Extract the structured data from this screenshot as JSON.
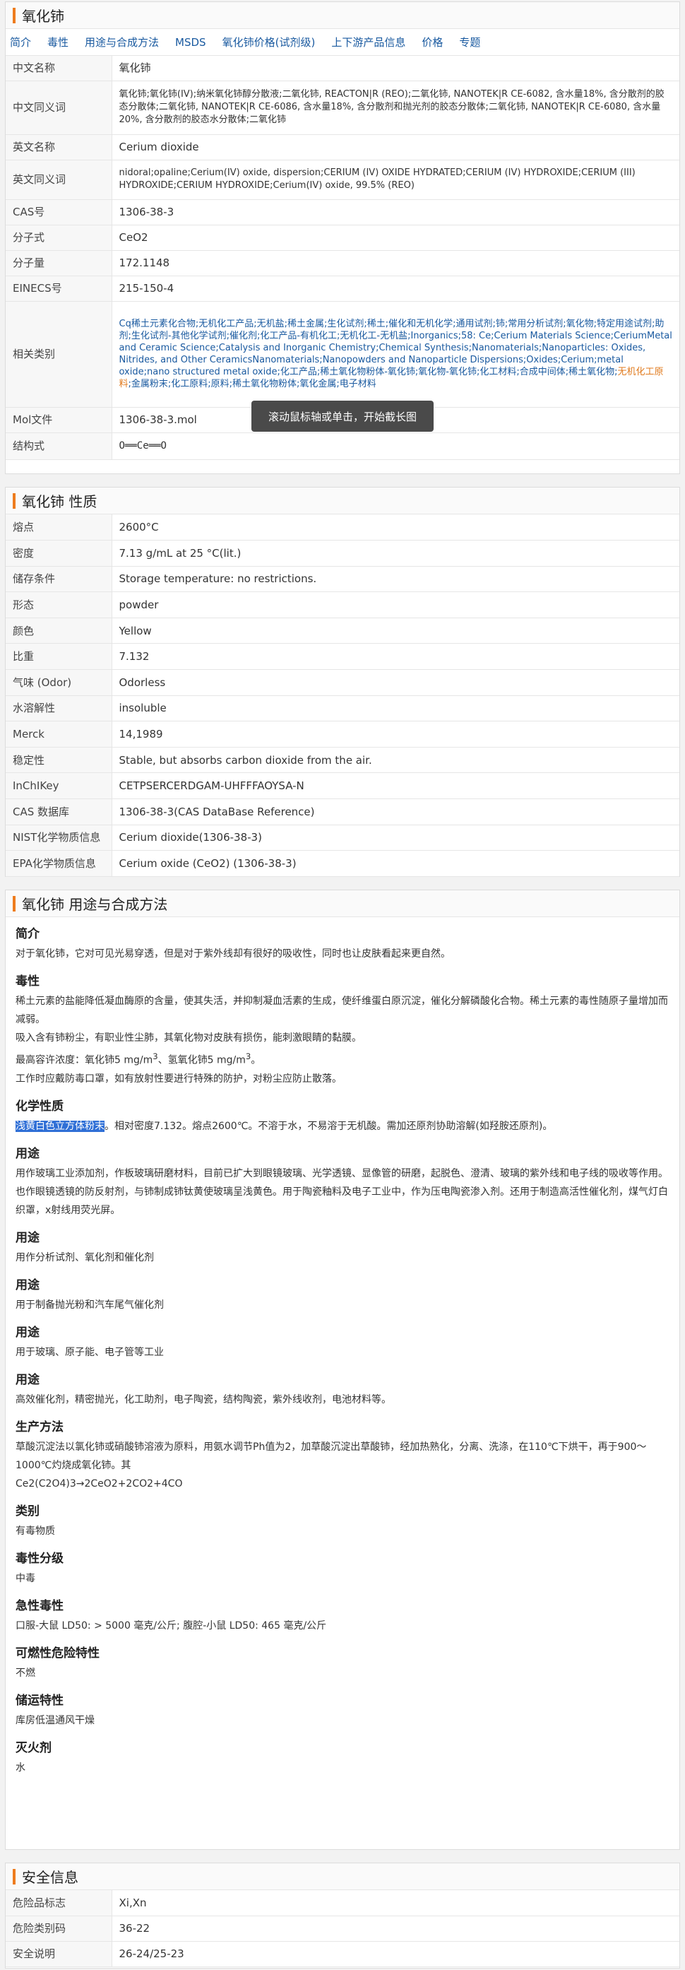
{
  "basic": {
    "title": "氧化铈",
    "nav": [
      "简介",
      "毒性",
      "用途与合成方法",
      "MSDS",
      "氧化铈价格(试剂级)",
      "上下游产品信息",
      "价格",
      "专题"
    ],
    "rows": [
      {
        "k": "中文名称",
        "v": "氧化铈"
      },
      {
        "k": "中文同义词",
        "v": "氧化铈;氧化铈(IV);纳米氧化铈醇分散液;二氧化铈, REACTON|R (REO);二氧化铈, NANOTEK|R CE-6082, 含水量18%, 含分散剂的胶态分散体;二氧化铈, NANOTEK|R CE-6086, 含水量18%, 含分散剂和抛光剂的胶态分散体;二氧化铈, NANOTEK|R CE-6080, 含水量20%, 含分散剂的胶态水分散体;二氧化铈"
      },
      {
        "k": "英文名称",
        "v": "Cerium dioxide"
      },
      {
        "k": "英文同义词",
        "v": "nidoral;opaline;Cerium(IV) oxide, dispersion;CERIUM (IV) OXIDE HYDRATED;CERIUM (IV) HYDROXIDE;CERIUM (III) HYDROXIDE;CERIUM HYDROXIDE;Cerium(IV) oxide, 99.5% (REO)"
      },
      {
        "k": "CAS号",
        "v": "1306-38-3"
      },
      {
        "k": "分子式",
        "v": "CeO2"
      },
      {
        "k": "分子量",
        "v": "172.1148"
      },
      {
        "k": "EINECS号",
        "v": "215-150-4"
      },
      {
        "k": "相关类别",
        "v": ""
      },
      {
        "k": "Mol文件",
        "v": "1306-38-3.mol"
      },
      {
        "k": "结构式",
        "v": ""
      }
    ],
    "category_a": "Cq稀土元素化合物;无机化工产品;无机盐;稀土金属;生化试剂;稀土;催化和无机化学;通用试剂;铈;常用分析试剂;氧化物;特定用途试剂;助剂;生化试剂-其他化学试剂;催化剂;化工产品-有机化工;无机化工-无机盐;Inorganics;58: Ce;Cerium Materials Science;CeriumMetal and Ceramic Science;Catalysis and Inorganic Chemistry;Chemical Synthesis;Nanomaterials;Nanoparticles: Oxides, Nitrides, and Other CeramicsNanomaterials;Nanopowders and Nanoparticle Dispersions;Oxides;Cerium;metal oxide;nano structured metal oxide;化工产品;稀土氧化物粉体-氧化铈;氧化物-氧化铈;化工材料;合成中间体;稀土氧化物;",
    "category_b": "无机化工原料",
    "category_c": ";金属粉末;化工原料;原料;稀土氧化物粉体;氧化金属;电子材料",
    "structure": "O══Ce══O",
    "tooltip": "滚动鼠标轴或单击，开始截长图"
  },
  "props": {
    "title": "氧化铈 性质",
    "rows": [
      {
        "k": "熔点",
        "v": "2600°C"
      },
      {
        "k": "密度",
        "v": "7.13 g/mL at 25 °C(lit.)"
      },
      {
        "k": "储存条件",
        "v": "Storage temperature: no restrictions."
      },
      {
        "k": "形态",
        "v": "powder"
      },
      {
        "k": "颜色",
        "v": "Yellow"
      },
      {
        "k": "比重",
        "v": "7.132"
      },
      {
        "k": "气味 (Odor)",
        "v": "Odorless"
      },
      {
        "k": "水溶解性",
        "v": "insoluble"
      },
      {
        "k": "Merck",
        "v": "14,1989"
      },
      {
        "k": "稳定性",
        "v": "Stable, but absorbs carbon dioxide from the air."
      },
      {
        "k": "InChIKey",
        "v": "CETPSERCERDGAM-UHFFFAOYSA-N"
      },
      {
        "k": "CAS 数据库",
        "v": "1306-38-3(CAS DataBase Reference)"
      },
      {
        "k": "NIST化学物质信息",
        "v": "Cerium dioxide(1306-38-3)"
      },
      {
        "k": "EPA化学物质信息",
        "v": "Cerium oxide (CeO2) (1306-38-3)"
      }
    ]
  },
  "uses": {
    "title": "氧化铈 用途与合成方法",
    "intro_h": "简介",
    "intro": "对于氧化铈，它对可见光易穿透，但是对于紫外线却有很好的吸收性，同时也让皮肤看起来更自然。",
    "tox_h": "毒性",
    "tox1": "稀土元素的盐能降低凝血酶原的含量，使其失活，并抑制凝血活素的生成，使纤维蛋白原沉淀，催化分解磷酸化合物。稀土元素的毒性随原子量增加而减弱。",
    "tox2": "吸入含有铈粉尘，有职业性尘肺，其氧化物对皮肤有损伤，能刺激眼睛的黏膜。",
    "tox3_a": "最高容许浓度：氧化铈5 mg/m",
    "tox3_b": "3",
    "tox3_c": "、氢氧化铈5 mg/m",
    "tox3_d": "3",
    "tox3_e": "。",
    "tox4": "工作时应戴防毒口罩，如有放射性要进行特殊的防护，对粉尘应防止散落。",
    "chem_h": "化学性质",
    "chem_hl": "浅黄白色立方体粉末",
    "chem_rest": "。相对密度7.132。熔点2600℃。不溶于水，不易溶于无机酸。需加还原剂协助溶解(如羟胺还原剂)。",
    "use1_h": "用途",
    "use1": "用作玻璃工业添加剂，作板玻璃研磨材料，目前已扩大到眼镜玻璃、光学透镜、显像管的研磨，起脱色、澄清、玻璃的紫外线和电子线的吸收等作用。也作眼镜透镜的防反射剂，与铈制成铈钛黄使玻璃呈浅黄色。用于陶瓷釉料及电子工业中，作为压电陶瓷渗入剂。还用于制造高活性催化剂，煤气灯白织罩，x射线用荧光屏。",
    "use2_h": "用途",
    "use2": "用作分析试剂、氧化剂和催化剂",
    "use3_h": "用途",
    "use3": "用于制备抛光粉和汽车尾气催化剂",
    "use4_h": "用途",
    "use4": "用于玻璃、原子能、电子管等工业",
    "use5_h": "用途",
    "use5": "高效催化剂，精密抛光，化工助剂，电子陶瓷，结构陶瓷，紫外线收剂，电池材料等。",
    "prod_h": "生产方法",
    "prod1": "草酸沉淀法以氯化铈或硝酸铈溶液为原料，用氨水调节Ph值为2，加草酸沉淀出草酸铈，经加热熟化，分离、洗涤，在110℃下烘干，再于900～1000℃灼烧成氧化铈。其",
    "prod2": "Ce2(C2O4)3→2CeO2+2CO2+4CO",
    "cat_h": "类别",
    "cat": "有毒物质",
    "grade_h": "毒性分级",
    "grade": "中毒",
    "acute_h": "急性毒性",
    "acute": "口服-大鼠 LD50: > 5000 毫克/公斤; 腹腔-小鼠 LD50: 465 毫克/公斤",
    "fire_h": "可燃性危险特性",
    "fire": "不燃",
    "store_h": "储运特性",
    "store": "库房低温通风干燥",
    "ext_h": "灭火剂",
    "ext": "水"
  },
  "safety": {
    "title": "安全信息",
    "rows": [
      {
        "k": "危险品标志",
        "v": "Xi,Xn"
      },
      {
        "k": "危险类别码",
        "v": "36-22"
      },
      {
        "k": "安全说明",
        "v": "26-24/25-23"
      }
    ]
  }
}
